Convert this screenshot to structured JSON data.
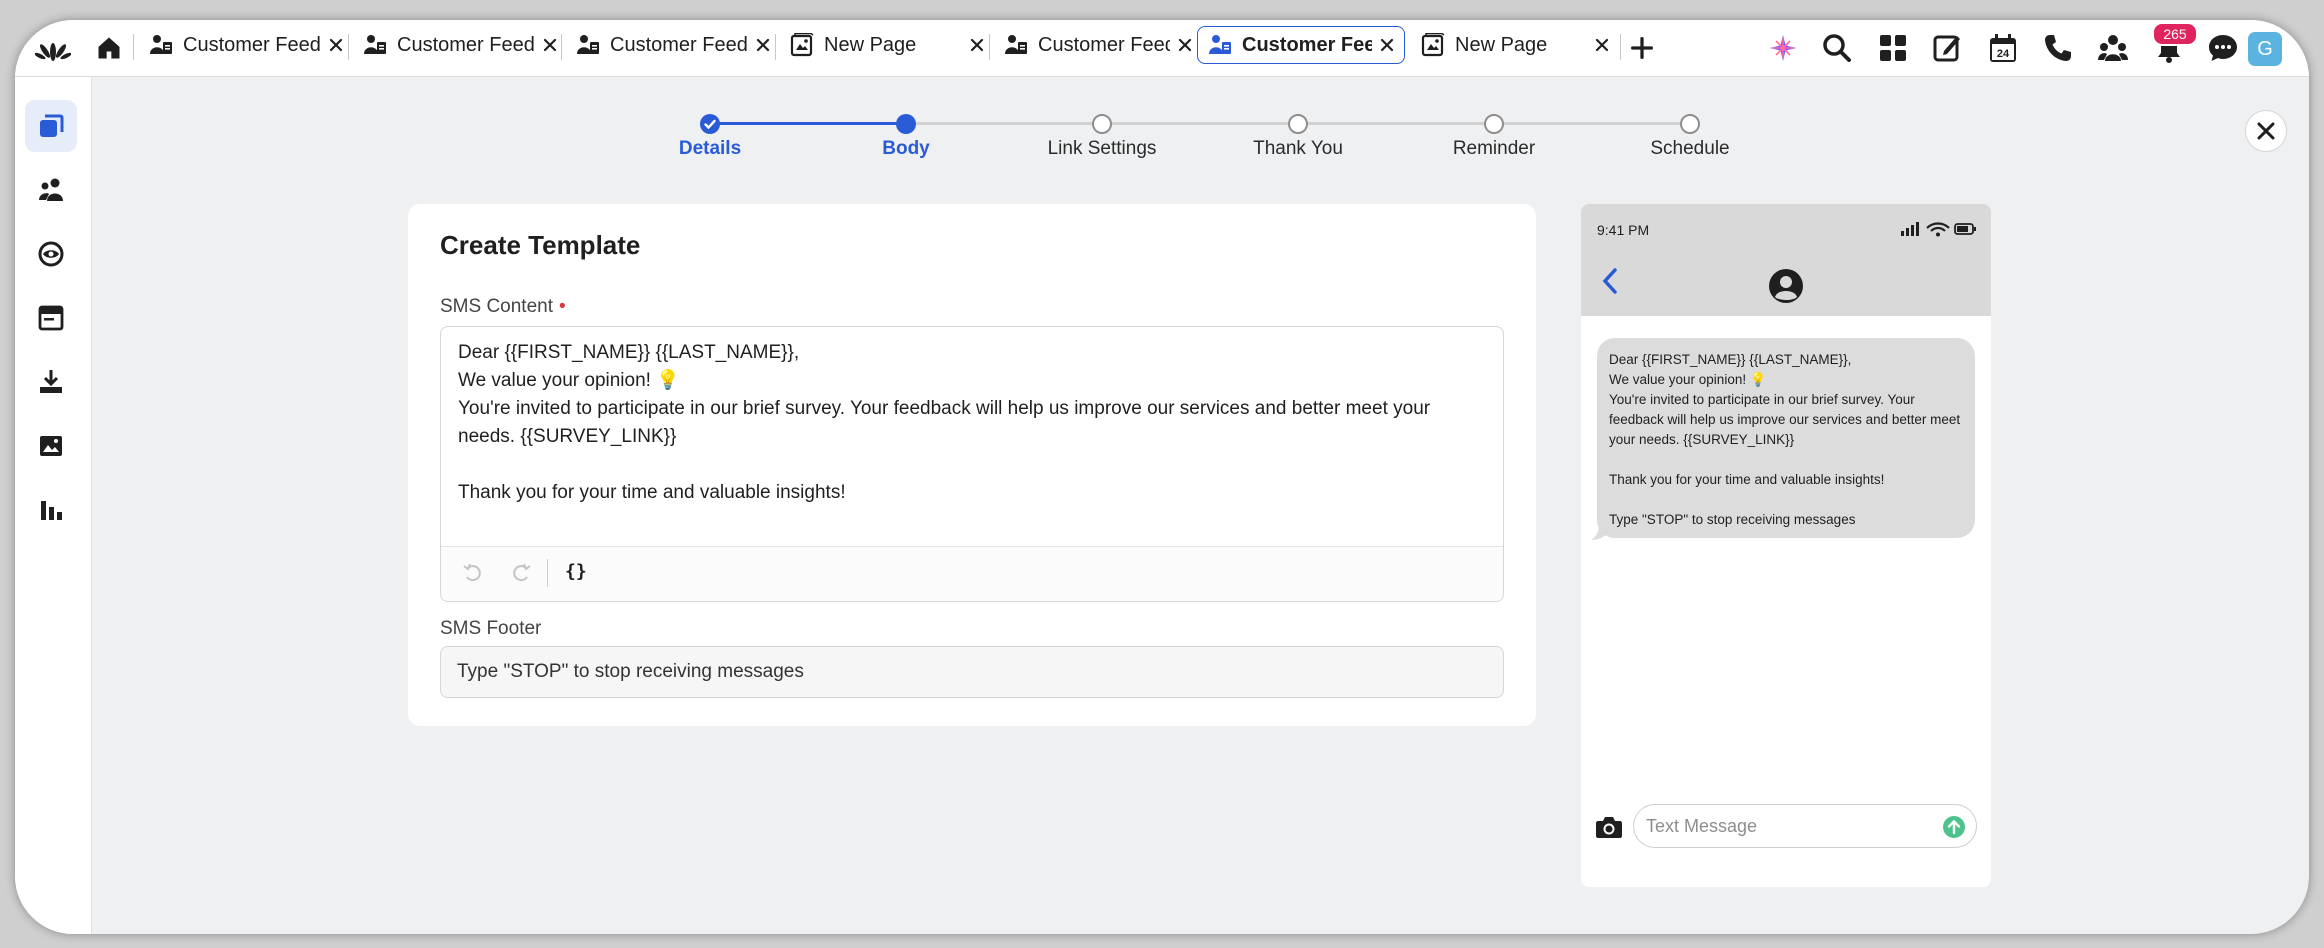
{
  "tabs": [
    {
      "label": "Customer Feedback",
      "active": false,
      "icon": "survey-icon"
    },
    {
      "label": "Customer Feedback",
      "active": false,
      "icon": "survey-icon"
    },
    {
      "label": "Customer Feedback",
      "active": false,
      "icon": "survey-icon"
    },
    {
      "label": "New Page",
      "active": false,
      "icon": "page-icon"
    },
    {
      "label": "Customer Feedback",
      "active": false,
      "icon": "survey-icon"
    },
    {
      "label": "Customer Feedback",
      "active": true,
      "icon": "survey-icon"
    },
    {
      "label": "New Page",
      "active": false,
      "icon": "page-icon"
    }
  ],
  "topbar": {
    "notification_count": "265",
    "avatar_initial": "G",
    "calendar_day": "24"
  },
  "stepper": {
    "steps": [
      "Details",
      "Body",
      "Link Settings",
      "Thank You",
      "Reminder",
      "Schedule"
    ],
    "current": 1
  },
  "form": {
    "title": "Create Template",
    "sms_content_label": "SMS Content",
    "required_mark": "•",
    "sms_content_lines": [
      "Dear {{FIRST_NAME}} {{LAST_NAME}},",
      "We value your opinion! 💡",
      "You're invited to participate in our brief survey. Your feedback will help us improve our services and better meet your needs. {{SURVEY_LINK}}",
      "",
      "Thank you for your time and valuable insights!"
    ],
    "variable_button_label": "{}",
    "sms_footer_label": "SMS Footer",
    "sms_footer_value": "Type \"STOP\" to stop receiving messages"
  },
  "preview": {
    "time": "9:41 PM",
    "message_lines": [
      "Dear {{FIRST_NAME}} {{LAST_NAME}},",
      "We value your opinion! 💡",
      "You're invited to participate in our brief survey. Your feedback will help us improve our services and better meet your needs. {{SURVEY_LINK}}",
      "",
      "Thank you for your time and valuable insights!",
      "",
      "Type \"STOP\" to stop receiving messages"
    ],
    "input_placeholder": "Text Message"
  },
  "colors": {
    "accent": "#2a5bd7",
    "badge": "#e0245e",
    "send": "#4cc38a"
  }
}
